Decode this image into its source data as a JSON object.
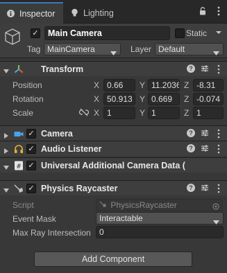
{
  "tabs": {
    "inspector": "Inspector",
    "lighting": "Lighting"
  },
  "gameobject": {
    "active": true,
    "name": "Main Camera",
    "static_label": "Static",
    "static": false,
    "tag_label": "Tag",
    "tag_value": "MainCamera",
    "layer_label": "Layer",
    "layer_value": "Default"
  },
  "transform": {
    "title": "Transform",
    "position_label": "Position",
    "rotation_label": "Rotation",
    "scale_label": "Scale",
    "position": {
      "x": "0.66",
      "y": "11.2036",
      "z": "-8.31"
    },
    "rotation": {
      "x": "50.913",
      "y": "0.669",
      "z": "-0.074"
    },
    "scale": {
      "x": "1",
      "y": "1",
      "z": "1"
    },
    "axis": {
      "x": "X",
      "y": "Y",
      "z": "Z"
    }
  },
  "components": {
    "camera": "Camera",
    "audio_listener": "Audio Listener",
    "urp_camera_data": "Universal Additional Camera Data (",
    "physics_raycaster": "Physics Raycaster"
  },
  "physics_raycaster": {
    "script_label": "Script",
    "script_value": "PhysicsRaycaster",
    "event_mask_label": "Event Mask",
    "event_mask_value": "Interactable",
    "max_ray_label": "Max Ray Intersection",
    "max_ray_value": "0"
  },
  "add_component": "Add Component",
  "colors": {
    "tab_accent": "#3a79bb",
    "transform_icon_green": "#7ec94a",
    "camera_icon_blue": "#4aa3e8",
    "audio_icon_yellow": "#e8b23a"
  }
}
